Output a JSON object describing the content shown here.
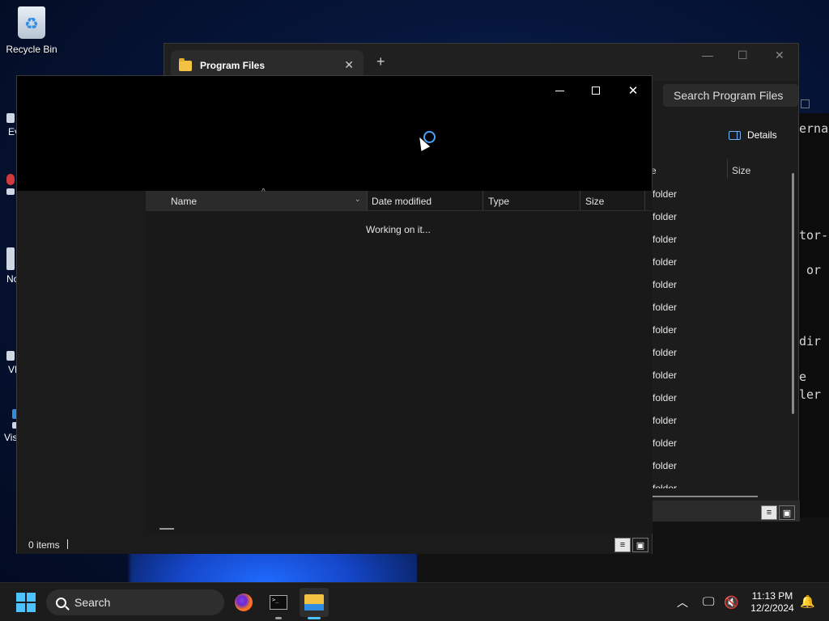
{
  "desktop": {
    "icons": [
      {
        "label": "Recycle Bin"
      },
      {
        "label": "Ev"
      },
      {
        "label": "No"
      },
      {
        "label": "VL"
      },
      {
        "label": "Vis"
      }
    ]
  },
  "back_window": {
    "tab_title": "Program Files",
    "search_placeholder": "Search Program Files",
    "details_label": "Details",
    "col_e": "e",
    "col_size": "Size",
    "row_type": "folder",
    "terminal_lines": [
      "erna",
      "tor-",
      " or",
      "dir",
      "e",
      "ler"
    ]
  },
  "front_window": {
    "columns": {
      "name": "Name",
      "date_modified": "Date modified",
      "type": "Type",
      "size": "Size"
    },
    "loading_text": "Working on it...",
    "status_items": "0 items"
  },
  "taskbar": {
    "search_label": "Search",
    "time": "11:13 PM",
    "date": "12/2/2024",
    "apps": [
      "firefox-icon",
      "terminal-icon",
      "file-explorer-icon"
    ]
  },
  "colors": {
    "accent": "#4cc2ff",
    "spinner": "#4aa3ff",
    "folder": "#f3c243"
  }
}
